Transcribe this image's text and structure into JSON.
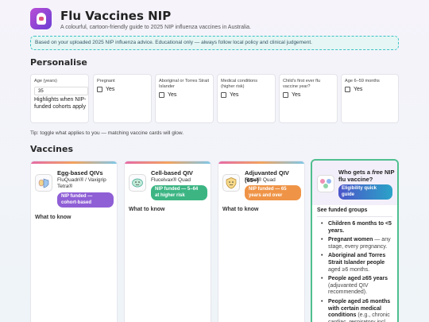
{
  "app": {
    "title": "Flu Vaccines NIP",
    "subtitle": "A colourful, cartoon-friendly guide to 2025 NIP influenza vaccines in Australia."
  },
  "notice": "Based on your uploaded 2025 NIP influenza advice. Educational only — always follow local policy and clinical judgement.",
  "personalise": {
    "heading": "Personalise",
    "age": {
      "label": "Age (years)",
      "value": "35",
      "help": "Highlights when NIP-funded cohorts apply"
    },
    "options": [
      {
        "label": "Pregnant",
        "check_label": "Yes"
      },
      {
        "label": "Aboriginal or Torres Strait Islander",
        "check_label": "Yes"
      },
      {
        "label": "Medical conditions (higher risk)",
        "check_label": "Yes"
      },
      {
        "label": "Child's first ever flu vaccine year?",
        "check_label": "Yes"
      },
      {
        "label": "Age 6–59 months",
        "check_label": "Yes"
      }
    ],
    "tip": "Tip: toggle what applies to you — matching vaccine cards will glow."
  },
  "vaccines": {
    "heading": "Vaccines",
    "cards": [
      {
        "name": "Egg-based QIVs",
        "brand": "FluQuadri® / Vaxigrip Tetra®",
        "badge": "NIP funded — cohort-based",
        "badge_color": "#8f5fd6",
        "more": "What to know",
        "icon": "shield-eggs-icon"
      },
      {
        "name": "Cell-based QIV",
        "brand": "Flucelvax® Quad",
        "badge": "NIP funded — 5–64 at higher risk",
        "badge_color": "#3cb583",
        "more": "What to know",
        "icon": "cell-icon"
      },
      {
        "name": "Adjuvanted QIV (65+)",
        "brand": "Fluad® Quad",
        "badge": "NIP funded — 65 years and over",
        "badge_color": "#ef9447",
        "more": "What to know",
        "icon": "shield-smile-icon"
      }
    ],
    "eligibility": {
      "title_pre": "Who gets a ",
      "title_em": "free",
      "title_post": " NIP flu vaccine?",
      "badge": "Eligibility quick guide",
      "link": "See funded groups",
      "items": [
        {
          "bold": "Children 6 months to <5 years.",
          "normal": ""
        },
        {
          "bold": "Pregnant women",
          "normal": " — any stage, every pregnancy."
        },
        {
          "bold": "Aboriginal and Torres Strait Islander people",
          "normal": " aged ≥6 months."
        },
        {
          "bold": "People aged ≥65 years",
          "normal": " (adjuvanted QIV recommended)."
        },
        {
          "bold": "People aged ≥6 months with certain medical conditions",
          "normal": " (e.g., chronic cardiac, respiratory incl."
        }
      ]
    }
  },
  "colors": {
    "accent_purple": "#7b45d3",
    "notice_border": "#39c3c3",
    "eligibility_border": "#4fbf8f"
  }
}
